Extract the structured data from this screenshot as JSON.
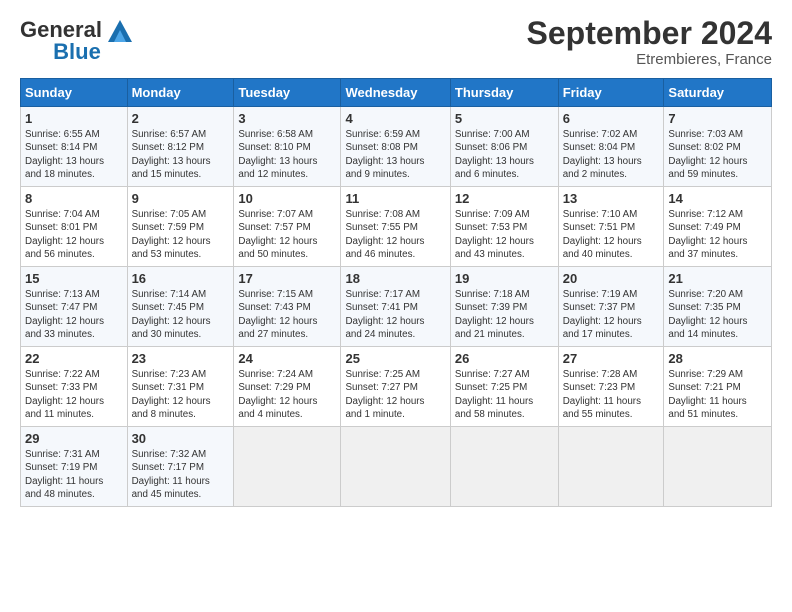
{
  "header": {
    "logo_general": "General",
    "logo_blue": "Blue",
    "month": "September 2024",
    "location": "Etrembieres, France"
  },
  "weekdays": [
    "Sunday",
    "Monday",
    "Tuesday",
    "Wednesday",
    "Thursday",
    "Friday",
    "Saturday"
  ],
  "rows": [
    [
      {
        "day": "1",
        "info": "Sunrise: 6:55 AM\nSunset: 8:14 PM\nDaylight: 13 hours\nand 18 minutes."
      },
      {
        "day": "2",
        "info": "Sunrise: 6:57 AM\nSunset: 8:12 PM\nDaylight: 13 hours\nand 15 minutes."
      },
      {
        "day": "3",
        "info": "Sunrise: 6:58 AM\nSunset: 8:10 PM\nDaylight: 13 hours\nand 12 minutes."
      },
      {
        "day": "4",
        "info": "Sunrise: 6:59 AM\nSunset: 8:08 PM\nDaylight: 13 hours\nand 9 minutes."
      },
      {
        "day": "5",
        "info": "Sunrise: 7:00 AM\nSunset: 8:06 PM\nDaylight: 13 hours\nand 6 minutes."
      },
      {
        "day": "6",
        "info": "Sunrise: 7:02 AM\nSunset: 8:04 PM\nDaylight: 13 hours\nand 2 minutes."
      },
      {
        "day": "7",
        "info": "Sunrise: 7:03 AM\nSunset: 8:02 PM\nDaylight: 12 hours\nand 59 minutes."
      }
    ],
    [
      {
        "day": "8",
        "info": "Sunrise: 7:04 AM\nSunset: 8:01 PM\nDaylight: 12 hours\nand 56 minutes."
      },
      {
        "day": "9",
        "info": "Sunrise: 7:05 AM\nSunset: 7:59 PM\nDaylight: 12 hours\nand 53 minutes."
      },
      {
        "day": "10",
        "info": "Sunrise: 7:07 AM\nSunset: 7:57 PM\nDaylight: 12 hours\nand 50 minutes."
      },
      {
        "day": "11",
        "info": "Sunrise: 7:08 AM\nSunset: 7:55 PM\nDaylight: 12 hours\nand 46 minutes."
      },
      {
        "day": "12",
        "info": "Sunrise: 7:09 AM\nSunset: 7:53 PM\nDaylight: 12 hours\nand 43 minutes."
      },
      {
        "day": "13",
        "info": "Sunrise: 7:10 AM\nSunset: 7:51 PM\nDaylight: 12 hours\nand 40 minutes."
      },
      {
        "day": "14",
        "info": "Sunrise: 7:12 AM\nSunset: 7:49 PM\nDaylight: 12 hours\nand 37 minutes."
      }
    ],
    [
      {
        "day": "15",
        "info": "Sunrise: 7:13 AM\nSunset: 7:47 PM\nDaylight: 12 hours\nand 33 minutes."
      },
      {
        "day": "16",
        "info": "Sunrise: 7:14 AM\nSunset: 7:45 PM\nDaylight: 12 hours\nand 30 minutes."
      },
      {
        "day": "17",
        "info": "Sunrise: 7:15 AM\nSunset: 7:43 PM\nDaylight: 12 hours\nand 27 minutes."
      },
      {
        "day": "18",
        "info": "Sunrise: 7:17 AM\nSunset: 7:41 PM\nDaylight: 12 hours\nand 24 minutes."
      },
      {
        "day": "19",
        "info": "Sunrise: 7:18 AM\nSunset: 7:39 PM\nDaylight: 12 hours\nand 21 minutes."
      },
      {
        "day": "20",
        "info": "Sunrise: 7:19 AM\nSunset: 7:37 PM\nDaylight: 12 hours\nand 17 minutes."
      },
      {
        "day": "21",
        "info": "Sunrise: 7:20 AM\nSunset: 7:35 PM\nDaylight: 12 hours\nand 14 minutes."
      }
    ],
    [
      {
        "day": "22",
        "info": "Sunrise: 7:22 AM\nSunset: 7:33 PM\nDaylight: 12 hours\nand 11 minutes."
      },
      {
        "day": "23",
        "info": "Sunrise: 7:23 AM\nSunset: 7:31 PM\nDaylight: 12 hours\nand 8 minutes."
      },
      {
        "day": "24",
        "info": "Sunrise: 7:24 AM\nSunset: 7:29 PM\nDaylight: 12 hours\nand 4 minutes."
      },
      {
        "day": "25",
        "info": "Sunrise: 7:25 AM\nSunset: 7:27 PM\nDaylight: 12 hours\nand 1 minute."
      },
      {
        "day": "26",
        "info": "Sunrise: 7:27 AM\nSunset: 7:25 PM\nDaylight: 11 hours\nand 58 minutes."
      },
      {
        "day": "27",
        "info": "Sunrise: 7:28 AM\nSunset: 7:23 PM\nDaylight: 11 hours\nand 55 minutes."
      },
      {
        "day": "28",
        "info": "Sunrise: 7:29 AM\nSunset: 7:21 PM\nDaylight: 11 hours\nand 51 minutes."
      }
    ],
    [
      {
        "day": "29",
        "info": "Sunrise: 7:31 AM\nSunset: 7:19 PM\nDaylight: 11 hours\nand 48 minutes."
      },
      {
        "day": "30",
        "info": "Sunrise: 7:32 AM\nSunset: 7:17 PM\nDaylight: 11 hours\nand 45 minutes."
      },
      {
        "day": "",
        "info": ""
      },
      {
        "day": "",
        "info": ""
      },
      {
        "day": "",
        "info": ""
      },
      {
        "day": "",
        "info": ""
      },
      {
        "day": "",
        "info": ""
      }
    ]
  ]
}
